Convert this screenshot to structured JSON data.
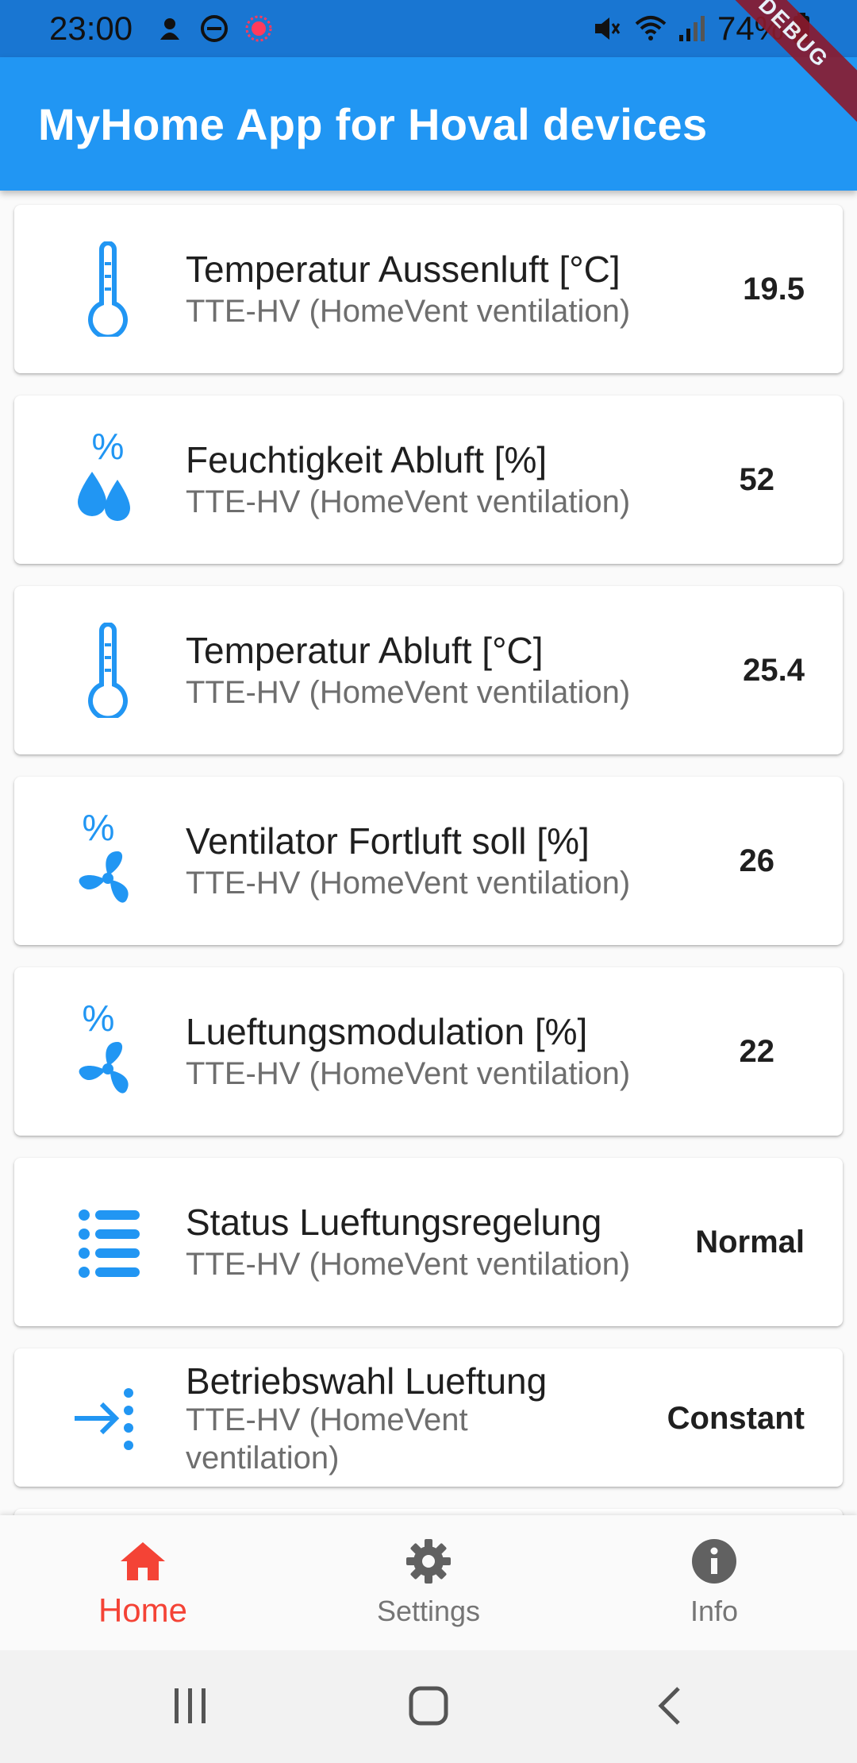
{
  "status_bar": {
    "time": "23:00",
    "battery": "74%",
    "icons": [
      "notification-icon",
      "dnd-icon",
      "recording-icon",
      "mute-icon",
      "wifi-icon",
      "signal-icon",
      "battery-icon"
    ]
  },
  "app_bar": {
    "title": "MyHome App for Hoval devices",
    "debug_label": "DEBUG"
  },
  "items": [
    {
      "name": "Temperatur Aussenluft [°C]",
      "device": "TTE-HV (HomeVent ventilation)",
      "value": "19.5",
      "icon": "thermometer-icon"
    },
    {
      "name": "Feuchtigkeit Abluft [%]",
      "device": "TTE-HV (HomeVent ventilation)",
      "value": "52",
      "icon": "humidity-icon"
    },
    {
      "name": "Temperatur Abluft [°C]",
      "device": "TTE-HV (HomeVent ventilation)",
      "value": "25.4",
      "icon": "thermometer-icon"
    },
    {
      "name": "Ventilator Fortluft soll [%]",
      "device": "TTE-HV (HomeVent ventilation)",
      "value": "26",
      "icon": "fan-percent-icon"
    },
    {
      "name": "Lueftungsmodulation [%]",
      "device": "TTE-HV (HomeVent ventilation)",
      "value": "22",
      "icon": "fan-percent-icon"
    },
    {
      "name": "Status Lueftungsregelung",
      "device": "TTE-HV (HomeVent ventilation)",
      "value": "Normal",
      "icon": "list-icon"
    },
    {
      "name": "Betriebswahl Lueftung",
      "device": "TTE-HV (HomeVent ventilation)",
      "value": "Constant",
      "icon": "arrow-dots-icon"
    }
  ],
  "bottom_nav": {
    "items": [
      {
        "label": "Home",
        "icon": "home-icon",
        "active": true
      },
      {
        "label": "Settings",
        "icon": "gear-icon",
        "active": false
      },
      {
        "label": "Info",
        "icon": "info-icon",
        "active": false
      }
    ]
  },
  "colors": {
    "primary": "#2196f3",
    "status_bar": "#1976d2",
    "icon_blue": "#2196f3",
    "active_nav": "#f44336",
    "inactive_nav": "#757575"
  }
}
